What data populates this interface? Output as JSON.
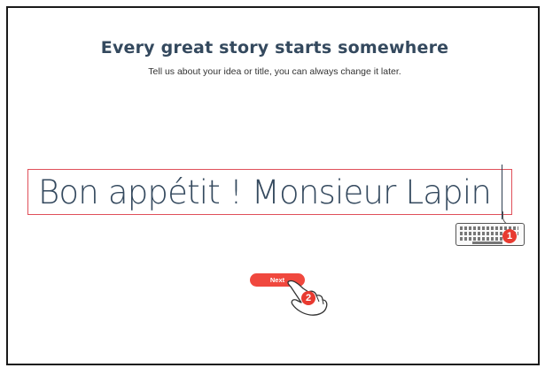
{
  "page": {
    "heading": "Every great story starts somewhere",
    "subheading": "Tell us about your idea or title, you can always change it later."
  },
  "title_input": {
    "value": "Bon appétit ! Monsieur Lapin"
  },
  "next_button": {
    "label": "Next"
  },
  "annotations": {
    "step_1": "1",
    "step_2": "2",
    "step_1_icon": "keyboard-icon",
    "step_2_icon": "hand-pointer-icon",
    "badge_color": "#e83a30"
  },
  "colors": {
    "accent": "#f0483e",
    "heading": "#34495e",
    "input_border": "#e0505a"
  }
}
